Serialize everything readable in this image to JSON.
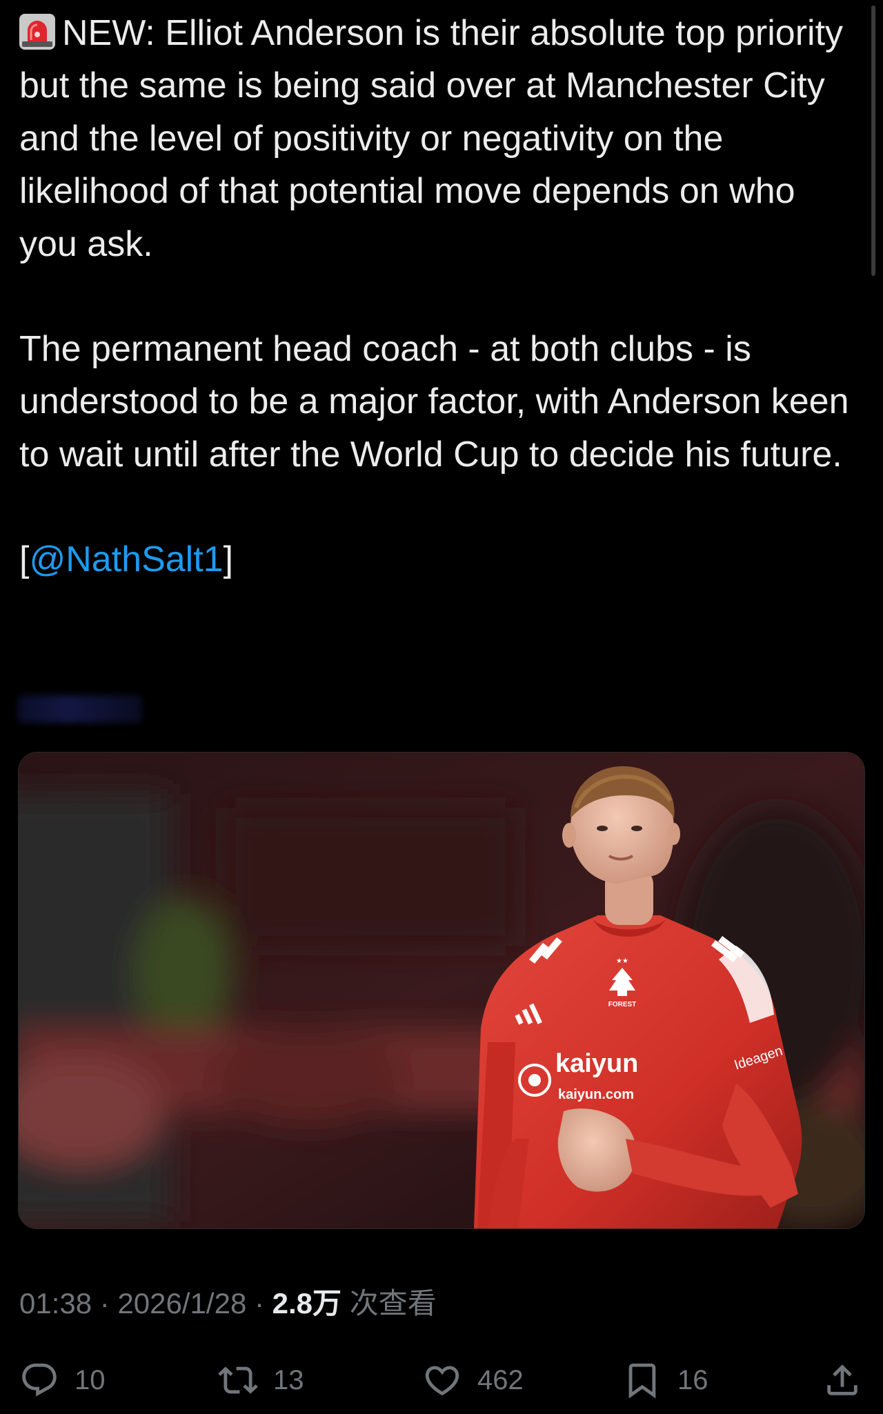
{
  "tweet": {
    "emoji_icon": "rotating-light-icon",
    "paragraph1": "NEW: Elliot Anderson is their absolute top priority but the same is being said over at Manchester City and the level of positivity or negativity on the likelihood of that potential move depends on who you ask.",
    "paragraph2": "The permanent head coach - at both clubs - is understood to be a major factor, with Anderson keen to wait until after the World Cup to decide his future.",
    "source_open": "[",
    "source_mention": "@NathSalt1",
    "source_close": "]"
  },
  "media": {
    "description_icon": "player-photo",
    "shirt_sponsor": "kaiyun",
    "shirt_sponsor_url": "kaiyun.com",
    "sleeve_sponsor": "Ideagen",
    "crest_text": "FOREST"
  },
  "meta": {
    "time": "01:38",
    "separator": "·",
    "date": "2026/1/28",
    "views_count": "2.8万",
    "views_label": "次查看"
  },
  "actions": {
    "reply_count": "10",
    "retweet_count": "13",
    "like_count": "462",
    "bookmark_count": "16"
  },
  "colors": {
    "background": "#000000",
    "text": "#ececec",
    "muted": "#71767b",
    "link": "#1d9bf0",
    "shirt_red": "#d6322b"
  }
}
